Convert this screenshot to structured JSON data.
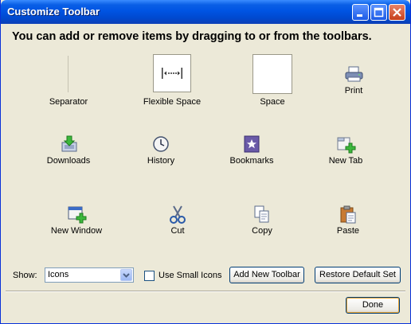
{
  "window": {
    "title": "Customize Toolbar"
  },
  "heading": "You can add or remove items by dragging to or from the toolbars.",
  "items": [
    {
      "label": "Separator",
      "icon": "separator-icon"
    },
    {
      "label": "Flexible Space",
      "icon": "flexible-space-icon"
    },
    {
      "label": "Space",
      "icon": "space-icon"
    },
    {
      "label": "Print",
      "icon": "printer-icon"
    },
    {
      "label": "Downloads",
      "icon": "download-icon"
    },
    {
      "label": "History",
      "icon": "clock-icon"
    },
    {
      "label": "Bookmarks",
      "icon": "bookmark-star-icon"
    },
    {
      "label": "New Tab",
      "icon": "new-tab-icon"
    },
    {
      "label": "New Window",
      "icon": "new-window-icon"
    },
    {
      "label": "Cut",
      "icon": "scissors-icon"
    },
    {
      "label": "Copy",
      "icon": "copy-icon"
    },
    {
      "label": "Paste",
      "icon": "paste-icon"
    }
  ],
  "controls": {
    "show_label": "Show:",
    "show_value": "Icons",
    "small_icons_label": "Use Small Icons",
    "small_icons_checked": false,
    "add_toolbar": "Add New Toolbar",
    "restore_default": "Restore Default Set",
    "done": "Done"
  },
  "colors": {
    "titlebar": "#0054e3",
    "dialog_bg": "#ece9d8",
    "accent_green": "#3cb83c"
  }
}
